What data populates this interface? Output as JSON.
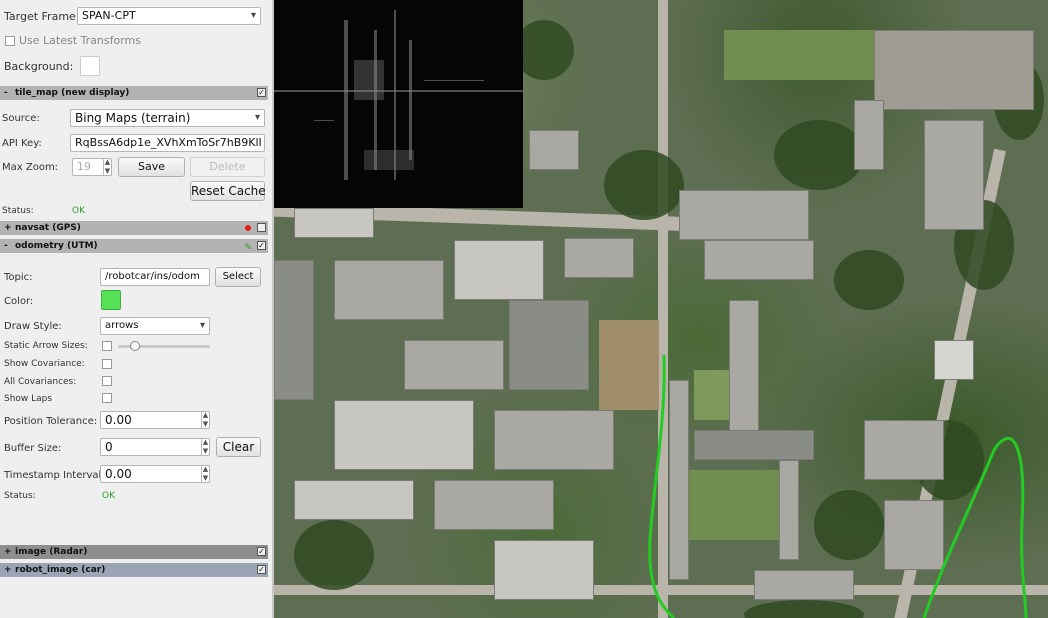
{
  "global": {
    "target_frame_label": "Target Frame:",
    "target_frame_value": "SPAN-CPT",
    "use_latest_transforms_label": "Use Latest Transforms",
    "background_label": "Background:"
  },
  "tile_map": {
    "title": "tile_map (new display)",
    "source_label": "Source:",
    "source_value": "Bing Maps (terrain)",
    "api_key_label": "API Key:",
    "api_key_value": "RqBssA6dp1e_XVhXmToSr7hB9KlI",
    "max_zoom_label": "Max Zoom:",
    "max_zoom_value": "19",
    "save_label": "Save",
    "delete_label": "Delete",
    "reset_cache_label": "Reset Cache",
    "status_label": "Status:",
    "status_value": "OK"
  },
  "navsat": {
    "title": "navsat (GPS)",
    "indicator_color": "#e0201c"
  },
  "odometry": {
    "title": "odometry (UTM)",
    "topic_label": "Topic:",
    "topic_value": "/robotcar/ins/odom",
    "select_label": "Select",
    "color_label": "Color:",
    "color_value": "#55e055",
    "draw_style_label": "Draw Style:",
    "draw_style_value": "arrows",
    "static_arrow_sizes_label": "Static Arrow Sizes:",
    "arrow_size_level": 0.15,
    "show_covariance_label": "Show Covariance:",
    "all_covariances_label": "All Covariances:",
    "show_laps_label": "Show Laps",
    "position_tolerance_label": "Position Tolerance:",
    "position_tolerance_value": "0.00",
    "buffer_size_label": "Buffer Size:",
    "buffer_size_value": "0",
    "clear_label": "Clear",
    "timestamp_interval_label": "Timestamp Interval:",
    "timestamp_interval_value": "0.00",
    "status_label": "Status:",
    "status_value": "OK"
  },
  "image_radar": {
    "title": "image (Radar)"
  },
  "robot_image": {
    "title": "robot_image (car)"
  },
  "track_color": "#22cc22"
}
